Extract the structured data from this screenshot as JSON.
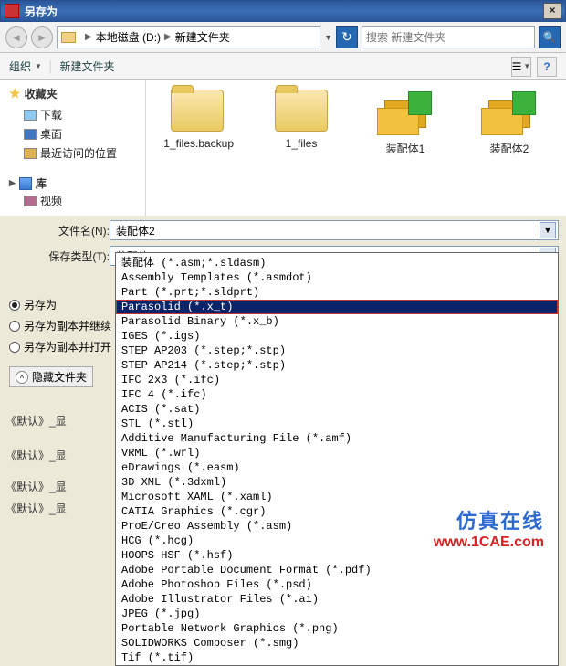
{
  "window": {
    "title": "另存为",
    "close": "×"
  },
  "address": {
    "drive": "本地磁盘 (D:)",
    "folder": "新建文件夹",
    "search_placeholder": "搜索 新建文件夹"
  },
  "toolbar": {
    "organize": "组织",
    "new_folder": "新建文件夹"
  },
  "sidebar": {
    "favorites": "收藏夹",
    "items": [
      {
        "label": "下载"
      },
      {
        "label": "桌面"
      },
      {
        "label": "最近访问的位置"
      }
    ],
    "library": "库",
    "library_items": [
      {
        "label": "视频"
      }
    ]
  },
  "files": [
    {
      "label": ".1_files.backup",
      "type": "folder"
    },
    {
      "label": "1_files",
      "type": "folder"
    },
    {
      "label": "装配体1",
      "type": "part"
    },
    {
      "label": "装配体2",
      "type": "part"
    }
  ],
  "fields": {
    "filename_label": "文件名(N):",
    "filename_value": "装配体2",
    "filetype_label": "保存类型(T):",
    "filetype_value": "装配体 (*.asm;*.sldasm)"
  },
  "radios": {
    "opt1": "另存为",
    "opt2": "另存为副本并继续",
    "opt3": "另存为副本并打开"
  },
  "hide_folders": "隐藏文件夹",
  "dropdown_items": [
    "装配体 (*.asm;*.sldasm)",
    "Assembly Templates (*.asmdot)",
    "Part (*.prt;*.sldprt)",
    "Parasolid (*.x_t)",
    "Parasolid Binary (*.x_b)",
    "IGES (*.igs)",
    "STEP AP203 (*.step;*.stp)",
    "STEP AP214 (*.step;*.stp)",
    "IFC 2x3 (*.ifc)",
    "IFC 4 (*.ifc)",
    "ACIS (*.sat)",
    "STL (*.stl)",
    "Additive Manufacturing File (*.amf)",
    "VRML (*.wrl)",
    "eDrawings (*.easm)",
    "3D XML (*.3dxml)",
    "Microsoft XAML (*.xaml)",
    "CATIA Graphics (*.cgr)",
    "ProE/Creo Assembly (*.asm)",
    "HCG (*.hcg)",
    "HOOPS HSF (*.hsf)",
    "Adobe Portable Document Format (*.pdf)",
    "Adobe Photoshop Files (*.psd)",
    "Adobe Illustrator Files (*.ai)",
    "JPEG (*.jpg)",
    "Portable Network Graphics (*.png)",
    "SOLIDWORKS Composer (*.smg)",
    "Tif (*.tif)"
  ],
  "dropdown_selected_index": 3,
  "stray_labels": [
    "《默认》_显",
    "《默认》_显",
    "《默认》_显",
    "《默认》_显"
  ],
  "watermark": {
    "line1": "仿真在线",
    "line2": "www.1CAE.com"
  }
}
